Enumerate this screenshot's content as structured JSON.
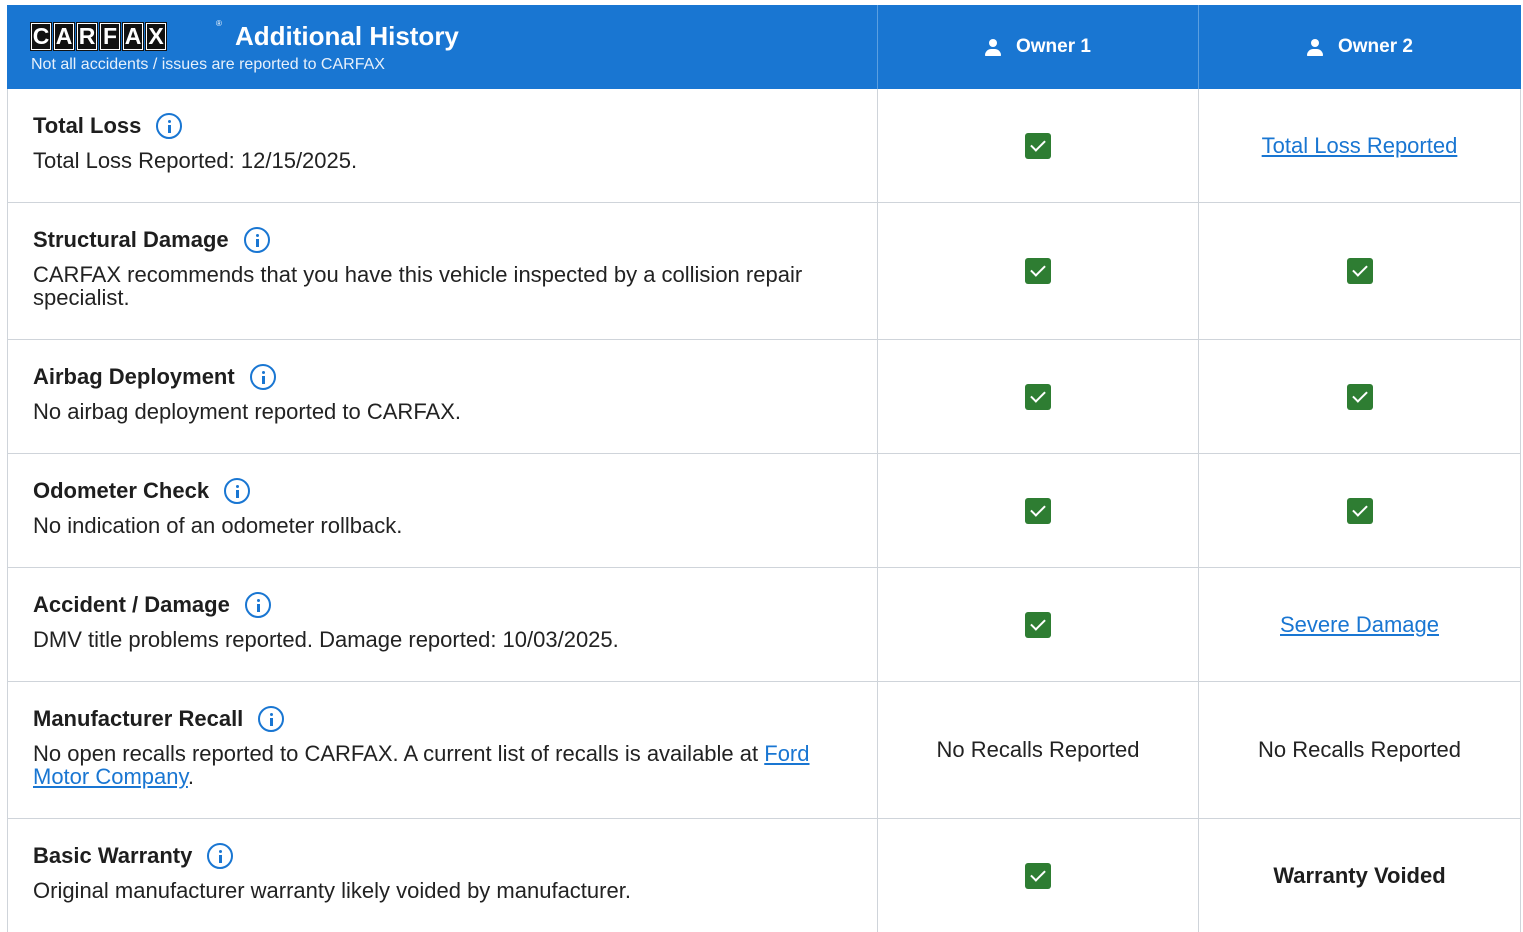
{
  "header": {
    "logo_letters": [
      "C",
      "A",
      "R",
      "F",
      "A",
      "X"
    ],
    "title": "Additional History",
    "subtitle": "Not all accidents / issues are reported to CARFAX",
    "owners": [
      "Owner 1",
      "Owner 2"
    ]
  },
  "rows": [
    {
      "label": "Total Loss",
      "desc": "Total Loss Reported: 12/15/2025.",
      "owner1": "check",
      "owner2_link": "Total Loss Reported"
    },
    {
      "label": "Structural Damage",
      "desc": "CARFAX recommends that you have this vehicle inspected by a collision repair specialist.",
      "owner1": "check",
      "owner2": "check"
    },
    {
      "label": "Airbag Deployment",
      "desc": "No airbag deployment reported to CARFAX.",
      "owner1": "check",
      "owner2": "check"
    },
    {
      "label": "Odometer Check",
      "desc": "No indication of an odometer rollback.",
      "owner1": "check",
      "owner2": "check"
    },
    {
      "label": "Accident / Damage",
      "desc": "DMV title problems reported. Damage reported: 10/03/2025.",
      "owner1": "check",
      "owner2_link": "Severe Damage"
    },
    {
      "label": "Manufacturer Recall",
      "desc": "No open recalls reported to CARFAX. A current list of recalls is available at",
      "desc_link": "Ford Motor Company",
      "desc_after": ".",
      "owner1_text": "No Recalls Reported",
      "owner2_text": "No Recalls Reported"
    },
    {
      "label": "Basic Warranty",
      "desc": "Original manufacturer warranty likely voided by manufacturer.",
      "owner1": "check",
      "owner2_text": "Warranty Voided"
    }
  ],
  "colors": {
    "header_bg": "#1976d2",
    "check_bg": "#2e7d32",
    "link": "#1976d2"
  }
}
